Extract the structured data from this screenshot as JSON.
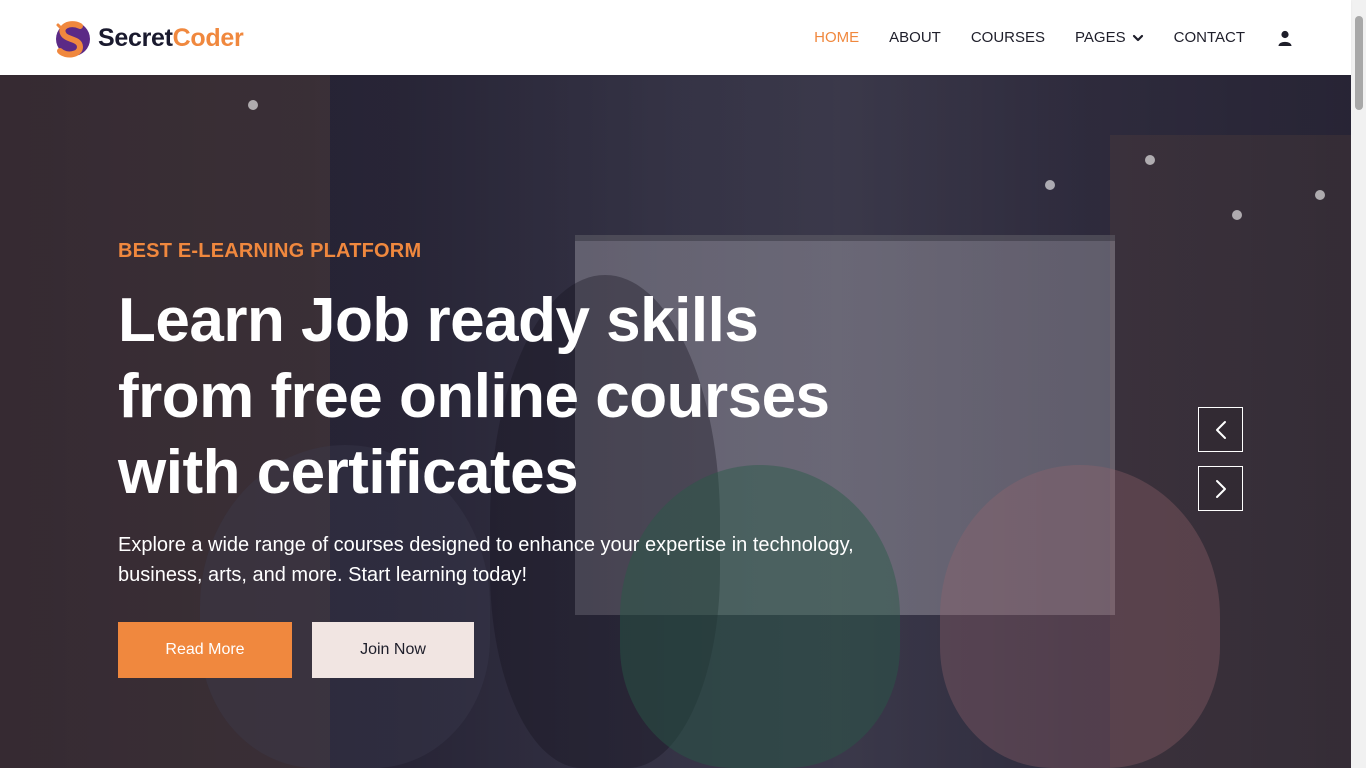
{
  "brand": {
    "part1": "Secret",
    "part2": "Coder"
  },
  "nav": {
    "items": [
      {
        "label": "HOME"
      },
      {
        "label": "ABOUT"
      },
      {
        "label": "COURSES"
      },
      {
        "label": "PAGES"
      },
      {
        "label": "CONTACT"
      }
    ],
    "active": "HOME"
  },
  "hero": {
    "eyebrow": "BEST E-LEARNING PLATFORM",
    "headline": "Learn Job ready skills from free online courses with certificates",
    "subtext": "Explore a wide range of courses designed to enhance your expertise in technology, business, arts, and more. Start learning today!",
    "primary_button": "Read More",
    "secondary_button": "Join Now"
  },
  "icons": {
    "user": "user-icon",
    "dropdown": "chevron-down-icon",
    "prev": "chevron-left-icon",
    "next": "chevron-right-icon"
  },
  "colors": {
    "accent": "#f0883e",
    "nav_text": "#1e1e2a",
    "secondary_button_bg": "#f1e5e2"
  }
}
